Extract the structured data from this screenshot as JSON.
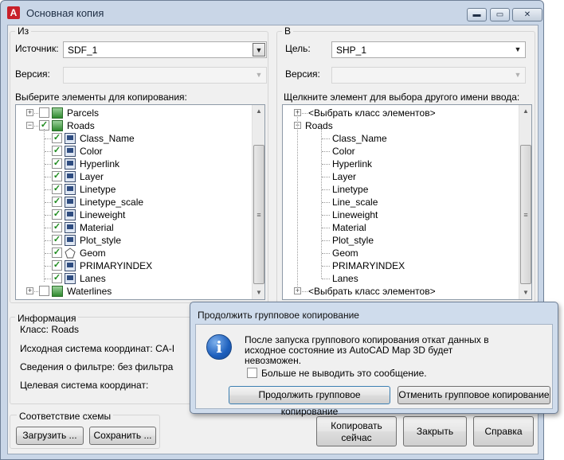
{
  "window": {
    "title": "Основная копия",
    "logo": "A",
    "minimize": "▬",
    "maximize": "▭",
    "close": "✕"
  },
  "from": {
    "group_label": "Из",
    "source_label": "Источник:",
    "source_value": "SDF_1",
    "version_label": "Версия:",
    "version_value": "",
    "tree_label": "Выберите элементы для копирования:",
    "tree": [
      {
        "label": "Parcels",
        "checked": false,
        "kind": "layer",
        "expander": "+"
      },
      {
        "label": "Roads",
        "checked": true,
        "kind": "layer",
        "expander": "−"
      },
      {
        "label": "Class_Name",
        "checked": true,
        "kind": "prop"
      },
      {
        "label": "Color",
        "checked": true,
        "kind": "prop"
      },
      {
        "label": "Hyperlink",
        "checked": true,
        "kind": "prop"
      },
      {
        "label": "Layer",
        "checked": true,
        "kind": "prop"
      },
      {
        "label": "Linetype",
        "checked": true,
        "kind": "prop"
      },
      {
        "label": "Linetype_scale",
        "checked": true,
        "kind": "prop"
      },
      {
        "label": "Lineweight",
        "checked": true,
        "kind": "prop"
      },
      {
        "label": "Material",
        "checked": true,
        "kind": "prop"
      },
      {
        "label": "Plot_style",
        "checked": true,
        "kind": "prop"
      },
      {
        "label": "Geom",
        "checked": true,
        "kind": "geom"
      },
      {
        "label": "PRIMARYINDEX",
        "checked": true,
        "kind": "prop"
      },
      {
        "label": "Lanes",
        "checked": true,
        "kind": "prop"
      },
      {
        "label": "Waterlines",
        "checked": false,
        "kind": "layer",
        "expander": "+"
      }
    ]
  },
  "to": {
    "group_label": "В",
    "target_label": "Цель:",
    "target_value": "SHP_1",
    "version_label": "Версия:",
    "version_value": "",
    "tree_label": "Щелкните элемент для выбора другого имени ввода:",
    "tree": [
      {
        "label": "<Выбрать класс элементов>",
        "expander": "+",
        "level": 0
      },
      {
        "label": "Roads",
        "expander": "−",
        "level": 0
      },
      {
        "label": "Class_Name",
        "level": 1
      },
      {
        "label": "Color",
        "level": 1
      },
      {
        "label": "Hyperlink",
        "level": 1
      },
      {
        "label": "Layer",
        "level": 1
      },
      {
        "label": "Linetype",
        "level": 1
      },
      {
        "label": "Line_scale",
        "level": 1
      },
      {
        "label": "Lineweight",
        "level": 1
      },
      {
        "label": "Material",
        "level": 1
      },
      {
        "label": "Plot_style",
        "level": 1
      },
      {
        "label": "Geom",
        "level": 1
      },
      {
        "label": "PRIMARYINDEX",
        "level": 1
      },
      {
        "label": "Lanes",
        "level": 1
      },
      {
        "label": "<Выбрать класс элементов>",
        "expander": "+",
        "level": 0
      }
    ]
  },
  "info": {
    "group_label": "Информация",
    "class": "Класс: Roads",
    "source_cs": "Исходная система координат: CA-I",
    "filter": "Сведения о фильтре: без фильтра",
    "target_cs": "Целевая система координат:"
  },
  "schema": {
    "group_label": "Соответствие схемы",
    "load": "Загрузить ...",
    "save": "Сохранить ..."
  },
  "buttons": {
    "copy_line1": "Копировать",
    "copy_line2": "сейчас",
    "close": "Закрыть",
    "help": "Справка"
  },
  "dialog": {
    "title": "Продолжить групповое копирование",
    "icon": "i",
    "message_line1": "После запуска группового копирования откат данных в",
    "message_line2": "исходное состояние из AutoCAD Map 3D будет",
    "message_line3": "невозможен.",
    "checkbox_label": "Больше не выводить это сообщение.",
    "checkbox_checked": false,
    "continue": "Продолжить групповое копирование",
    "cancel": "Отменить групповое копирование"
  }
}
